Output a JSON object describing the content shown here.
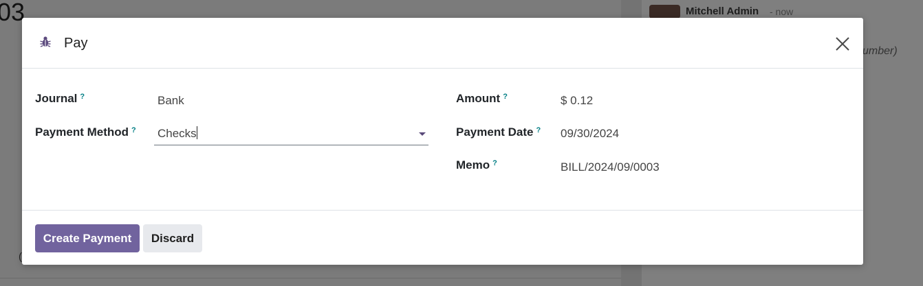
{
  "background": {
    "record_number": "03",
    "chatter": {
      "author": "Mitchell Admin",
      "time": "- now",
      "note": "umber)"
    },
    "bottom_left_text": "("
  },
  "dialog": {
    "title": "Pay",
    "header_icon": "bug-icon",
    "close_icon": "close-icon",
    "help_marker": "?",
    "fields": {
      "journal": {
        "label": "Journal",
        "value": "Bank"
      },
      "payment_method": {
        "label": "Payment Method",
        "value": "Checks"
      },
      "amount": {
        "label": "Amount",
        "value": "$ 0.12"
      },
      "payment_date": {
        "label": "Payment Date",
        "value": "09/30/2024"
      },
      "memo": {
        "label": "Memo",
        "value": "BILL/2024/09/0003"
      }
    },
    "buttons": {
      "create_payment": "Create Payment",
      "discard": "Discard"
    },
    "colors": {
      "primary": "#71639e",
      "help": "#017e84",
      "secondary_button": "#e7e9ed"
    }
  }
}
